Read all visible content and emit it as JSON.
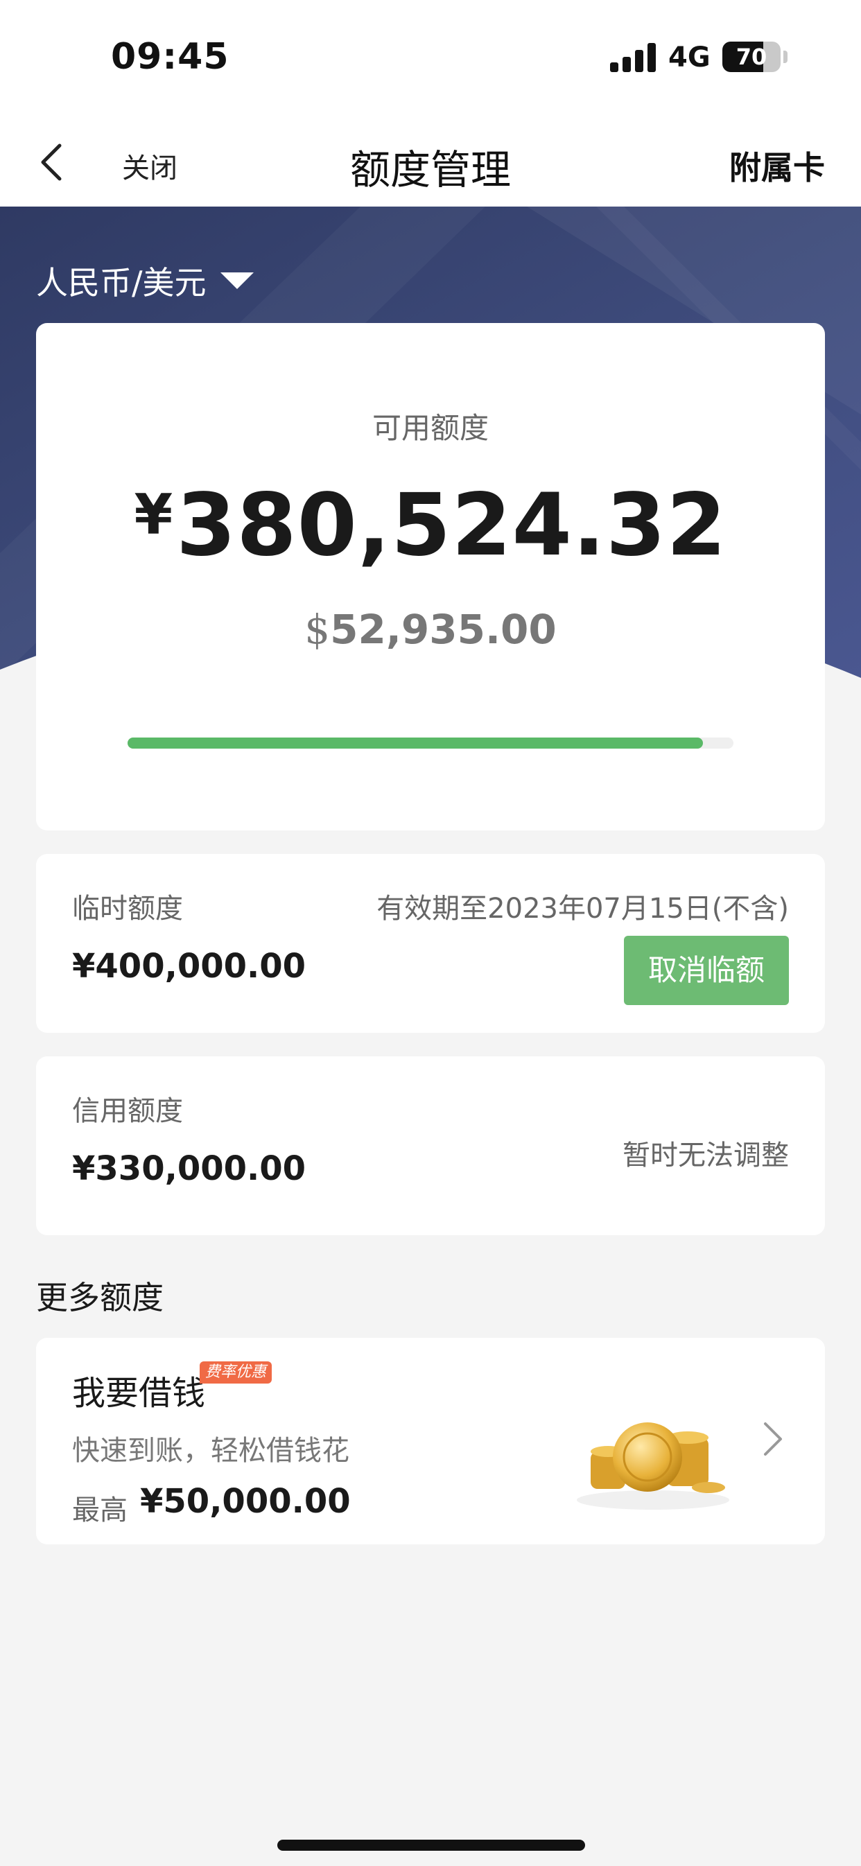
{
  "status_bar": {
    "time": "09:45",
    "network": "4G",
    "battery": "70",
    "battery_level": 0.7
  },
  "nav": {
    "close_label": "关闭",
    "title": "额度管理",
    "right_label": "附属卡"
  },
  "currency_selector": "人民币/美元",
  "available": {
    "label": "可用额度",
    "cny_symbol": "¥",
    "cny_amount": "380,524.32",
    "usd_symbol": "$",
    "usd_amount": "52,935.00",
    "progress_fraction": 0.95
  },
  "temporary": {
    "label": "临时额度",
    "validity": "有效期至2023年07月15日(不含)",
    "amount": "¥400,000.00",
    "cancel_label": "取消临额"
  },
  "credit": {
    "label": "信用额度",
    "amount": "¥330,000.00",
    "note": "暂时无法调整"
  },
  "more_section_title": "更多额度",
  "loan": {
    "title": "我要借钱",
    "badge": "费率优惠",
    "subtitle": "快速到账，轻松借钱花",
    "max_label": "最高",
    "max_amount": "¥50,000.00"
  },
  "colors": {
    "header_bg": "#3d4a7a",
    "accent_green": "#6dbb73",
    "badge_orange": "#f06a45"
  }
}
